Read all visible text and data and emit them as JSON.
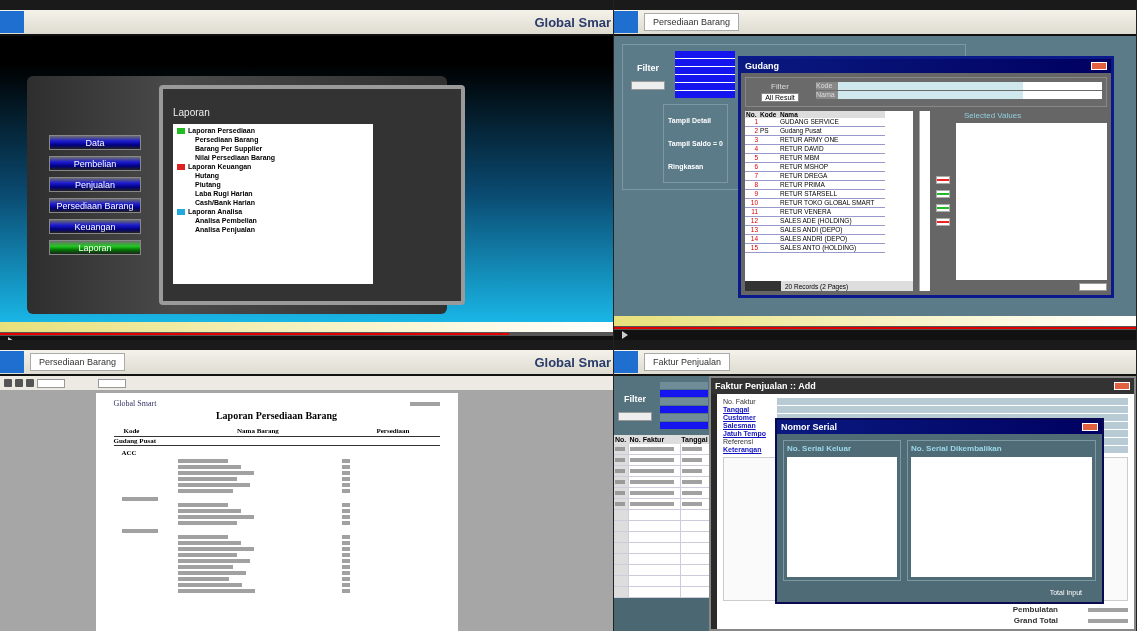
{
  "panels": [
    {
      "kind": "menu",
      "app_title": "Global Smar",
      "progress": {
        "level": 0.83
      },
      "menu": [
        {
          "label": "Data",
          "selected": false
        },
        {
          "label": "Pembelian",
          "selected": false
        },
        {
          "label": "Penjualan",
          "selected": false
        },
        {
          "label": "Persediaan Barang",
          "selected": false
        },
        {
          "label": "Keuangan",
          "selected": false
        },
        {
          "label": "Laporan",
          "selected": true
        }
      ],
      "panel_title": "Laporan",
      "tree": [
        {
          "label": "Laporan Persediaan",
          "color": "#22bb22",
          "children": [
            {
              "label": "Persediaan Barang"
            },
            {
              "label": "Barang Per Supplier"
            },
            {
              "label": "Nilai Persediaan Barang"
            }
          ]
        },
        {
          "label": "Laporan Keuangan",
          "color": "#dd2222",
          "children": [
            {
              "label": "Hutang"
            },
            {
              "label": "Piutang"
            },
            {
              "label": "Laba Rugi Harian"
            },
            {
              "label": "Cash/Bank Harian"
            }
          ]
        },
        {
          "label": "Laporan Analisa",
          "color": "#22aadd",
          "children": [
            {
              "label": "Analisa Pembelian"
            },
            {
              "label": "Analisa Penjualan"
            }
          ]
        }
      ]
    },
    {
      "kind": "gudang",
      "tab": "Persediaan Barang",
      "progress": {
        "level": 1
      },
      "filter_label": "Filter",
      "side_labels": [
        "Tampil Detail",
        "Tampil Saldo = 0",
        "Ringkasan"
      ],
      "dialog": {
        "title": "Gudang",
        "filter_label": "Filter",
        "fields": [
          "Kode",
          "Nama"
        ],
        "reset": "All Result",
        "columns": [
          "No.",
          "Kode",
          "Nama"
        ],
        "rows": [
          [
            "1",
            "",
            "GUDANG SERVICE"
          ],
          [
            "2",
            "PS",
            "Gudang Pusat"
          ],
          [
            "3",
            "",
            "RETUR ARMY ONE"
          ],
          [
            "4",
            "",
            "RETUR DAVID"
          ],
          [
            "5",
            "",
            "RETUR MBM"
          ],
          [
            "6",
            "",
            "RETUR MSHOP"
          ],
          [
            "7",
            "",
            "RETUR DREGA"
          ],
          [
            "8",
            "",
            "RETUR PRIMA"
          ],
          [
            "9",
            "",
            "RETUR STARSELL"
          ],
          [
            "10",
            "",
            "RETUR TOKO GLOBAL SMART"
          ],
          [
            "11",
            "",
            "RETUR VENERA"
          ],
          [
            "12",
            "",
            "SALES ADE (HOLDING)"
          ],
          [
            "13",
            "",
            "SALES ANDI (DEPO)"
          ],
          [
            "14",
            "",
            "SALES ANDRI (DEPO)"
          ],
          [
            "15",
            "",
            "SALES ANTO (HOLDING)"
          ]
        ],
        "records": "20 Records (2 Pages)",
        "selected_title": "Selected Values"
      }
    },
    {
      "kind": "report",
      "app_title": "Global Smar",
      "tab": "Persediaan Barang",
      "company": "Global Smart",
      "title": "Laporan Persediaan Barang",
      "columns": [
        "Kode",
        "Nama Barang",
        "Persediaan"
      ],
      "group": "Gudang Pusat",
      "subgroups": [
        {
          "label": "ACC"
        }
      ]
    },
    {
      "kind": "faktur",
      "tab": "Faktur Penjualan",
      "filter_label": "Filter",
      "list_columns": [
        "No.",
        "No. Faktur",
        "Tanggal"
      ],
      "dialog": {
        "title": "Faktur Penjualan :: Add",
        "fields": [
          "No. Faktur",
          "Tanggal",
          "Customer",
          "Salesman",
          "Jatuh Tempo",
          "Referensi",
          "Keterangan"
        ],
        "totals": [
          "Pembulatan",
          "Grand Total"
        ]
      },
      "serial": {
        "title": "Nomor Serial",
        "left_title": "No. Serial Keluar",
        "right_title": "No. Serial Dikembalikan",
        "total_label": "Total Input"
      }
    }
  ]
}
